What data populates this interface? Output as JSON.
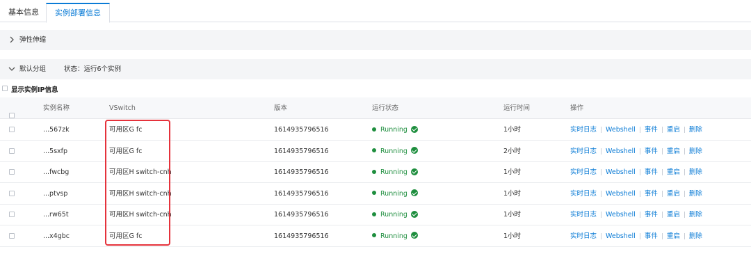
{
  "tabs": [
    {
      "label": "基本信息",
      "active": false
    },
    {
      "label": "实例部署信息",
      "active": true
    }
  ],
  "panels": {
    "elastic": {
      "label": "弹性伸缩"
    },
    "default_group": {
      "label": "默认分组",
      "status": "状态：运行6个实例"
    }
  },
  "show_ip": {
    "label": "显示实例IP信息"
  },
  "table": {
    "headers": {
      "name": "实例名称",
      "vswitch": "VSwitch",
      "version": "版本",
      "status": "运行状态",
      "uptime": "运行时间",
      "ops": "操作"
    },
    "rows": [
      {
        "name": "...567zk",
        "vswitch": "可用区G fc",
        "version": "1614935796516",
        "status": "Running",
        "uptime": "1小时"
      },
      {
        "name": "...5sxfp",
        "vswitch": "可用区G fc",
        "version": "1614935796516",
        "status": "Running",
        "uptime": "2小时"
      },
      {
        "name": "...fwcbg",
        "vswitch": "可用区H switch-cnh",
        "version": "1614935796516",
        "status": "Running",
        "uptime": "1小时"
      },
      {
        "name": "...ptvsp",
        "vswitch": "可用区H switch-cnh",
        "version": "1614935796516",
        "status": "Running",
        "uptime": "1小时"
      },
      {
        "name": "...rw65t",
        "vswitch": "可用区H switch-cnh",
        "version": "1614935796516",
        "status": "Running",
        "uptime": "1小时"
      },
      {
        "name": "...x4gbc",
        "vswitch": "可用区G fc",
        "version": "1614935796516",
        "status": "Running",
        "uptime": "1小时"
      }
    ],
    "ops": [
      "实时日志",
      "Webshell",
      "事件",
      "重启",
      "删除"
    ]
  },
  "colors": {
    "accent": "#0a7bd6",
    "running": "#1e8e3e",
    "highlight": "#e5323b"
  },
  "icons": {
    "panel_collapsed": "chevron-right-icon",
    "panel_expanded": "chevron-down-icon",
    "status_ok": "check-circle-icon"
  }
}
